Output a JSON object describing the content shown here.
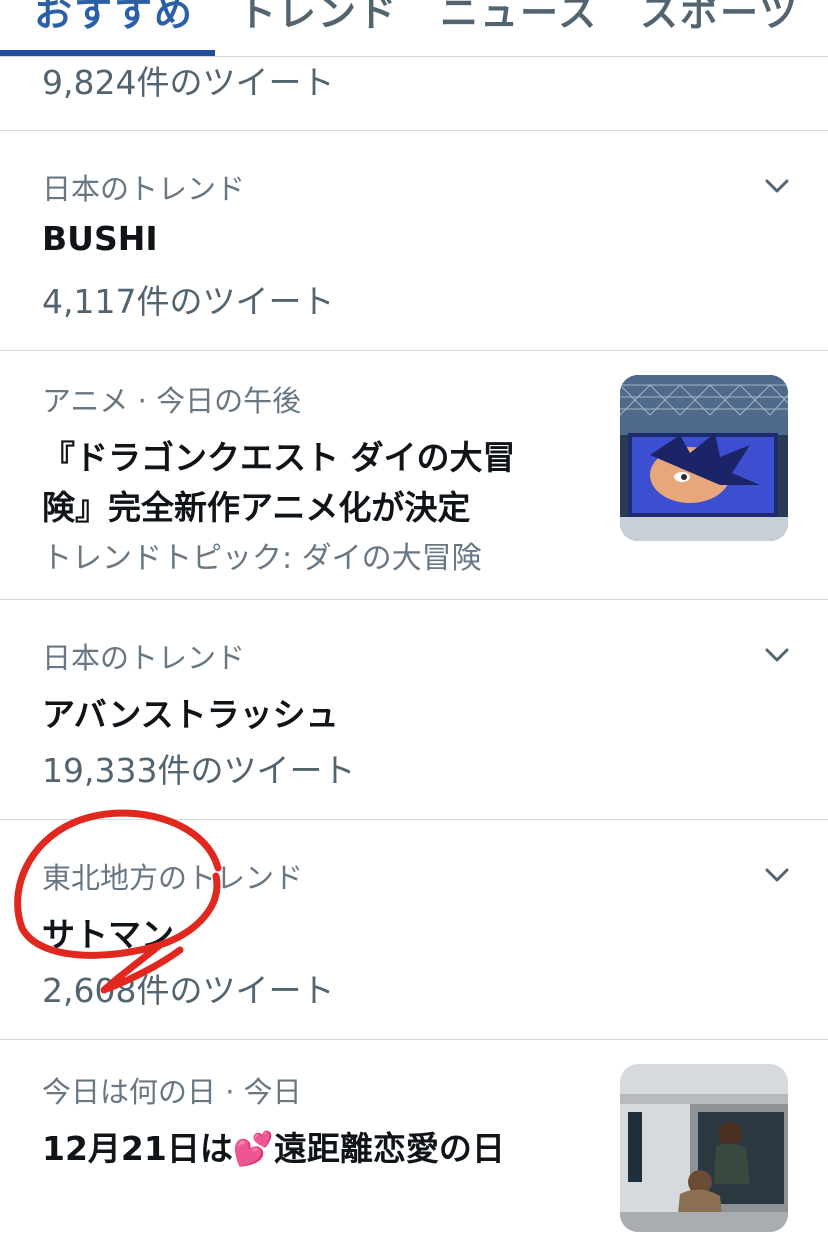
{
  "tabs": [
    "おすすめ",
    "トレンド",
    "ニュース",
    "スポーツ"
  ],
  "partial_top": {
    "count": "9,824件のツイート"
  },
  "trend1": {
    "context": "日本のトレンド",
    "title": "BUSHI",
    "count": "4,117件のツイート"
  },
  "news1": {
    "context": "アニメ · 今日の午後",
    "title_line1": "『ドラゴンクエスト ダイの大冒",
    "title_line2": "険』完全新作アニメ化が決定",
    "topic": "トレンドトピック: ダイの大冒険"
  },
  "trend2": {
    "context": "日本のトレンド",
    "title": "アバンストラッシュ",
    "count": "19,333件のツイート"
  },
  "trend3": {
    "context": "東北地方のトレンド",
    "title": "サトマン",
    "count": "2,608件のツイート"
  },
  "news2": {
    "context": "今日は何の日 · 今日",
    "title": "12月21日は💕遠距離恋愛の日"
  },
  "icons": {
    "more": "chevron-down-icon",
    "annotation": "red-circle-annotation"
  },
  "colors": {
    "active_tab": "#1f4e9a",
    "annotation": "#e0281f"
  }
}
